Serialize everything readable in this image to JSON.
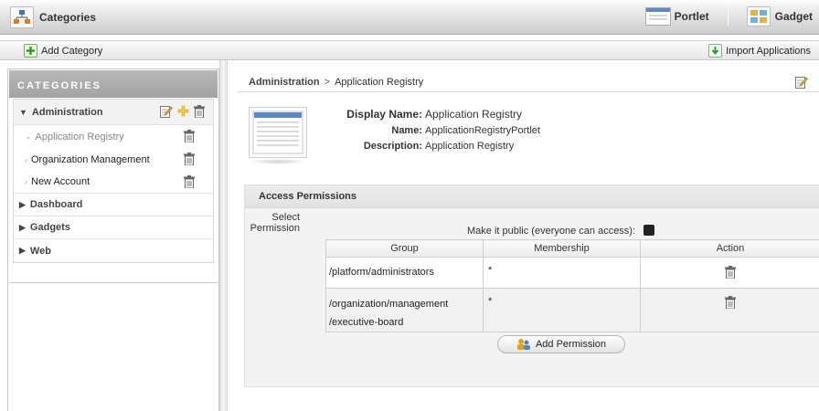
{
  "topbar": {
    "title": "Categories",
    "tabs": [
      {
        "label": "Portlet",
        "icon": "portlet-icon"
      },
      {
        "label": "Gadget",
        "icon": "gadget-icon"
      }
    ]
  },
  "toolbar": {
    "add_category": "Add Category",
    "import_applications": "Import Applications"
  },
  "sidebar": {
    "header": "CATEGORIES",
    "categories": [
      {
        "label": "Administration",
        "expanded": true,
        "items": [
          "Application Registry",
          "Organization Management",
          "New Account"
        ]
      },
      {
        "label": "Dashboard",
        "expanded": false
      },
      {
        "label": "Gadgets",
        "expanded": false
      },
      {
        "label": "Web",
        "expanded": false
      }
    ]
  },
  "main": {
    "breadcrumb": {
      "root": "Administration",
      "separator": ">",
      "current": "Application Registry"
    },
    "details": {
      "display_name_label": "Display Name:",
      "display_name_value": "Application Registry",
      "name_label": "Name:",
      "name_value": "ApplicationRegistryPortlet",
      "description_label": "Description:",
      "description_value": "Application Registry"
    },
    "access": {
      "header": "Access Permissions",
      "select_permission_line1": "Select",
      "select_permission_line2": "Permission",
      "make_public_label": "Make it public (everyone can access):",
      "table": {
        "columns": [
          "Group",
          "Membership",
          "Action"
        ],
        "rows": [
          {
            "group_line1": "/platform/administrators",
            "group_line2": "",
            "membership": "*"
          },
          {
            "group_line1": "/organization/management",
            "group_line2": "/executive-board",
            "membership": "*"
          }
        ]
      },
      "add_permission": "Add Permission"
    }
  },
  "colors": {
    "sidebar_header": "#a9a9a9",
    "checkbox": "#222222",
    "link_gray": "#888888"
  }
}
